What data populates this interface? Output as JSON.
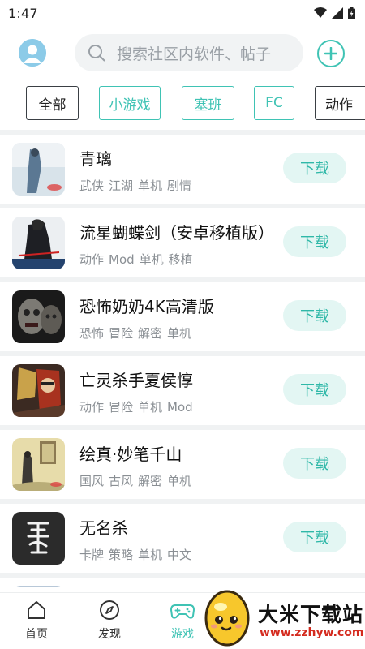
{
  "status_bar": {
    "time": "1:47"
  },
  "header": {
    "search_placeholder": "搜索社区内软件、帖子"
  },
  "categories": [
    {
      "label": "全部",
      "active": true
    },
    {
      "label": "小游戏",
      "active": false
    },
    {
      "label": "塞班",
      "active": false
    },
    {
      "label": "FC",
      "active": false
    },
    {
      "label": "动作",
      "active": false
    }
  ],
  "games": [
    {
      "title": "青璃",
      "tags": [
        "武侠",
        "江湖",
        "单机",
        "剧情"
      ],
      "button": "下载"
    },
    {
      "title": "流星蝴蝶剑（安卓移植版）",
      "tags": [
        "动作",
        "Mod",
        "单机",
        "移植"
      ],
      "button": "下载"
    },
    {
      "title": "恐怖奶奶4K高清版",
      "tags": [
        "恐怖",
        "冒险",
        "解密",
        "单机"
      ],
      "button": "下载"
    },
    {
      "title": "亡灵杀手夏侯惇",
      "tags": [
        "动作",
        "冒险",
        "单机",
        "Mod"
      ],
      "button": "下载"
    },
    {
      "title": "绘真·妙笔千山",
      "tags": [
        "国风",
        "古风",
        "解密",
        "单机"
      ],
      "button": "下载"
    },
    {
      "title": "无名杀",
      "tags": [
        "卡牌",
        "策略",
        "单机",
        "中文"
      ],
      "button": "下载"
    }
  ],
  "bottom_nav": [
    {
      "label": "首页",
      "icon": "home-icon",
      "active": false
    },
    {
      "label": "发现",
      "icon": "compass-icon",
      "active": false
    },
    {
      "label": "游戏",
      "icon": "gamepad-icon",
      "active": true
    }
  ],
  "watermark": {
    "name": "大米下载站",
    "url": "www.zzhyw.com"
  },
  "colors": {
    "accent": "#3fc3b4",
    "button_bg": "#e3f6f3",
    "tag_text": "#8a8f94"
  }
}
